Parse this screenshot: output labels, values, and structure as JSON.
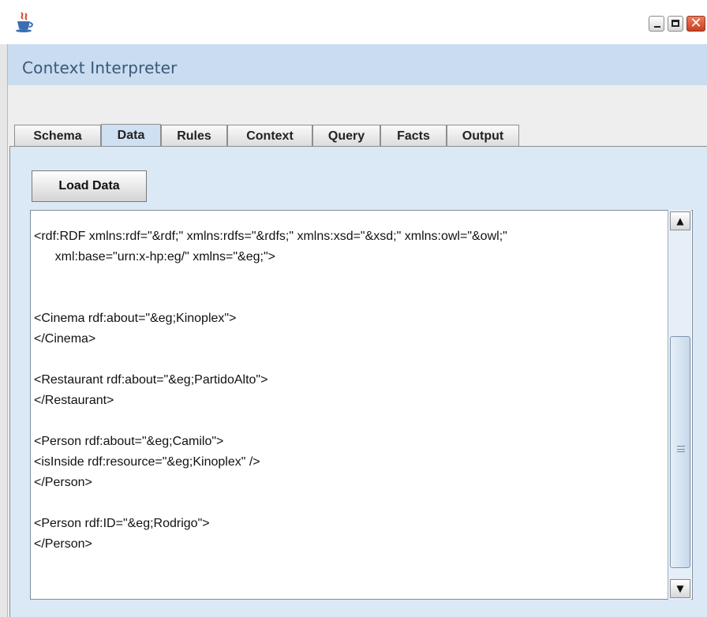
{
  "window": {
    "title": "",
    "app_icon": "java-coffee-icon",
    "controls": {
      "minimize": "minimize-icon",
      "maximize": "maximize-icon",
      "close_glyph": "✕"
    }
  },
  "header": {
    "title": "Context Interpreter"
  },
  "tabs": [
    {
      "label": "Schema",
      "active": false
    },
    {
      "label": "Data",
      "active": true
    },
    {
      "label": "Rules",
      "active": false
    },
    {
      "label": "Context",
      "active": false
    },
    {
      "label": "Query",
      "active": false
    },
    {
      "label": "Facts",
      "active": false
    },
    {
      "label": "Output",
      "active": false
    }
  ],
  "toolbar": {
    "load_label": "Load Data"
  },
  "editor": {
    "lines": [
      "<rdf:RDF xmlns:rdf=\"&rdf;\" xmlns:rdfs=\"&rdfs;\" xmlns:xsd=\"&xsd;\" xmlns:owl=\"&owl;\"",
      "      xml:base=\"urn:x-hp:eg/\" xmlns=\"&eg;\">",
      "",
      "",
      "<Cinema rdf:about=\"&eg;Kinoplex\">",
      "</Cinema>",
      "",
      "<Restaurant rdf:about=\"&eg;PartidoAlto\">",
      "</Restaurant>",
      "",
      "<Person rdf:about=\"&eg;Camilo\">",
      "<isInside rdf:resource=\"&eg;Kinoplex\" />",
      "</Person>",
      "",
      "<Person rdf:ID=\"&eg;Rodrigo\">",
      "</Person>"
    ]
  },
  "scrollbar": {
    "up_glyph": "▲",
    "down_glyph": "▼"
  },
  "colors": {
    "header_bg": "#c9dcf0",
    "active_tab": "#cfe0f2",
    "panel_bg": "#dbe8f5",
    "close_button": "#d9532e"
  }
}
